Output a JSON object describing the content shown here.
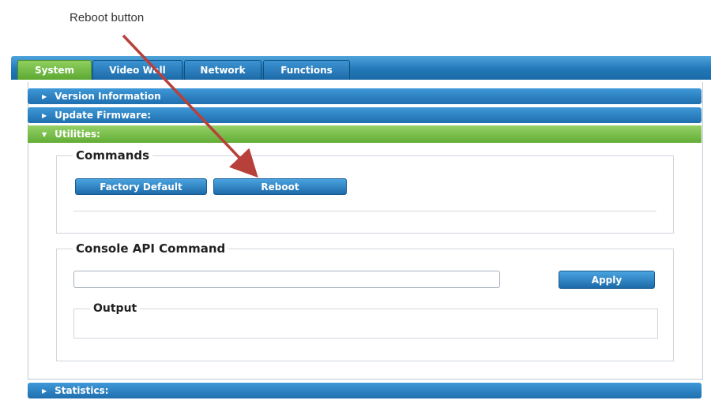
{
  "callout": {
    "label": "Reboot button"
  },
  "tabs": [
    {
      "label": "System",
      "active": true
    },
    {
      "label": "Video Wall",
      "active": false
    },
    {
      "label": "Network",
      "active": false
    },
    {
      "label": "Functions",
      "active": false
    }
  ],
  "sections": {
    "version": {
      "label": "Version Information",
      "state": "collapsed"
    },
    "firmware": {
      "label": "Update Firmware:",
      "state": "collapsed"
    },
    "utilities": {
      "label": "Utilities:",
      "state": "expanded"
    },
    "statistics": {
      "label": "Statistics:",
      "state": "collapsed"
    }
  },
  "commands": {
    "legend": "Commands",
    "factory_default_label": "Factory Default",
    "reboot_label": "Reboot"
  },
  "console": {
    "legend": "Console API Command",
    "input_value": "",
    "apply_label": "Apply",
    "output_legend": "Output",
    "output_value": ""
  },
  "colors": {
    "tab_blue": "#2179b8",
    "active_green": "#62ad35",
    "arrow_red": "#b8403a"
  },
  "icons": {
    "collapsed": "triangle-right-icon",
    "expanded": "triangle-down-icon"
  }
}
